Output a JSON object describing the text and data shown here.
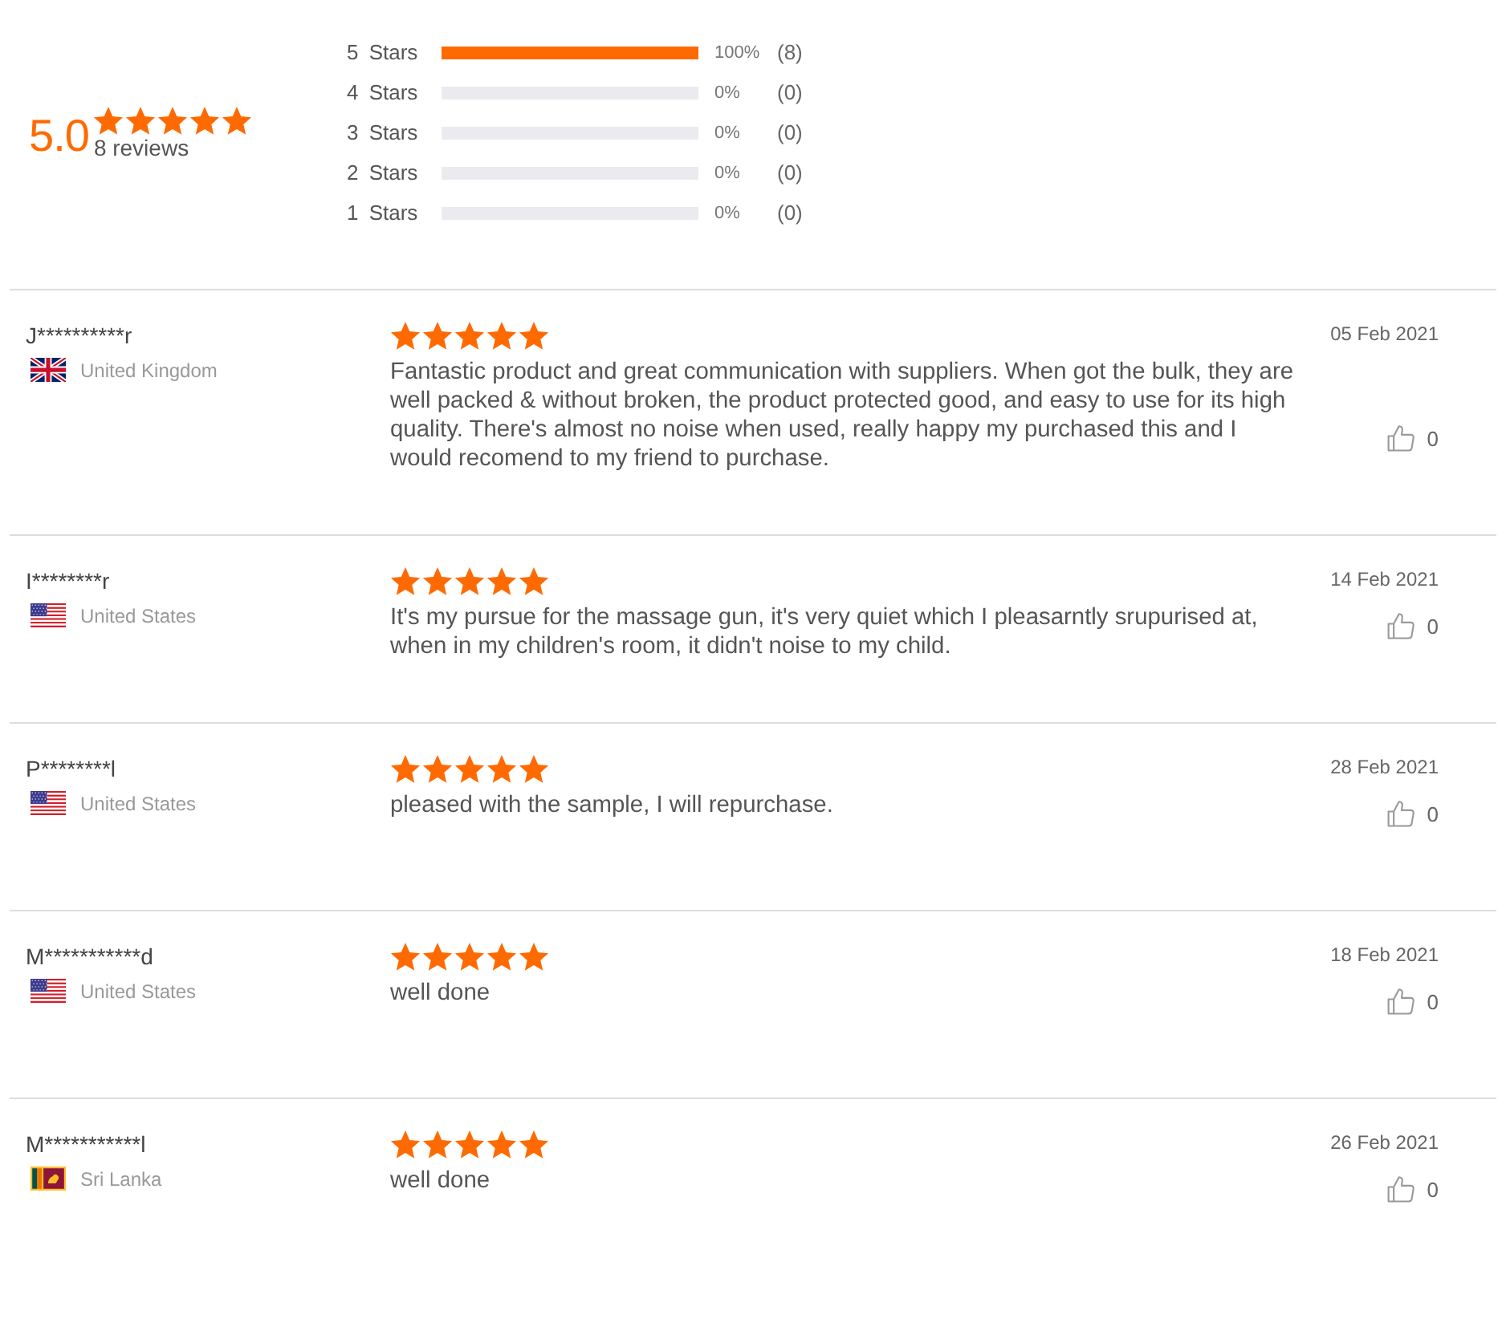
{
  "summary": {
    "rating": "5.0",
    "stars": 5,
    "count_label": "8 reviews"
  },
  "breakdown": [
    {
      "label": "5 Stars",
      "level": 1,
      "percent": "100%",
      "count": "(8)"
    },
    {
      "label": "4 Stars",
      "level": 0,
      "percent": "0%",
      "count": "(0)"
    },
    {
      "label": "3 Stars",
      "level": 0,
      "percent": "0%",
      "count": "(0)"
    },
    {
      "label": "2 Stars",
      "level": 0,
      "percent": "0%",
      "count": "(0)"
    },
    {
      "label": "1 Stars",
      "level": 0,
      "percent": "0%",
      "count": "(0)"
    }
  ],
  "reviews": [
    {
      "name": "J**********r",
      "kind": "uk",
      "country": "United Kingdom",
      "stars": 5,
      "text": "Fantastic product and great communication with suppliers. When got the bulk, they are well packed & without broken, the product protected good, and easy to use for its high quality. There's almost no noise when used, really happy my purchased this and I would recomend to my friend to purchase.",
      "date": "05 Feb 2021",
      "likes": "0"
    },
    {
      "name": "I********r",
      "kind": "us",
      "country": "United States",
      "stars": 5,
      "text": "It's my pursue for the massage gun, it's very quiet which I pleasarntly srupurised at, when in my children's room, it didn't noise to my child.",
      "date": "14 Feb 2021",
      "likes": "0"
    },
    {
      "name": "P********l",
      "kind": "us",
      "country": "United States",
      "stars": 5,
      "text": "pleased with the sample, I will repurchase.",
      "date": "28 Feb 2021",
      "likes": "0"
    },
    {
      "name": "M***********d",
      "kind": "us",
      "country": "United States",
      "stars": 5,
      "text": "well done",
      "date": "18 Feb 2021",
      "likes": "0"
    },
    {
      "name": "M***********l",
      "kind": "lk",
      "country": "Sri Lanka",
      "stars": 5,
      "text": "well done",
      "date": "26 Feb 2021",
      "likes": "0"
    }
  ]
}
